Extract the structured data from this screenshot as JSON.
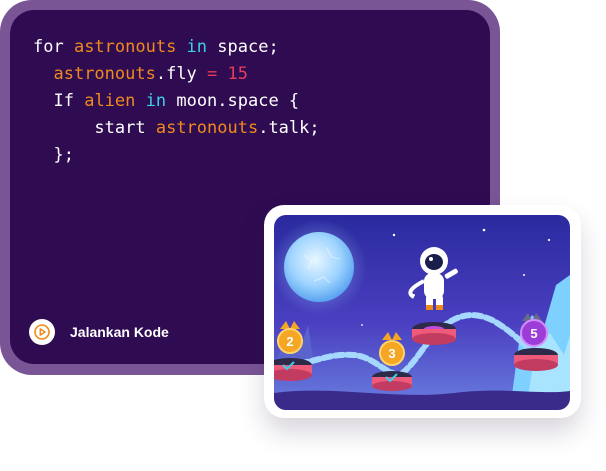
{
  "code": {
    "lines": [
      {
        "indent": "",
        "tokens": [
          {
            "text": "for ",
            "color": "#ffffff"
          },
          {
            "text": "astronouts",
            "color": "#f08a1c"
          },
          {
            "text": " in ",
            "color": "#3ad0e8"
          },
          {
            "text": "space;",
            "color": "#ffffff"
          }
        ]
      },
      {
        "indent": "  ",
        "tokens": [
          {
            "text": "astronouts",
            "color": "#f08a1c"
          },
          {
            "text": ".fly ",
            "color": "#ffffff"
          },
          {
            "text": "=",
            "color": "#e83a5a"
          },
          {
            "text": " 15",
            "color": "#e83a5a"
          }
        ]
      },
      {
        "indent": "  ",
        "tokens": [
          {
            "text": "If ",
            "color": "#ffffff"
          },
          {
            "text": "alien",
            "color": "#f08a1c"
          },
          {
            "text": " in ",
            "color": "#3ad0e8"
          },
          {
            "text": "moon.space {",
            "color": "#ffffff"
          }
        ]
      },
      {
        "indent": "      ",
        "tokens": [
          {
            "text": "start ",
            "color": "#ffffff"
          },
          {
            "text": "astronouts",
            "color": "#f08a1c"
          },
          {
            "text": ".talk;",
            "color": "#ffffff"
          }
        ]
      },
      {
        "indent": "  ",
        "tokens": [
          {
            "text": "};",
            "color": "#ffffff"
          }
        ]
      }
    ]
  },
  "run_button": {
    "label": "Jalankan Kode",
    "icon": "play-icon",
    "accent": "#f08a1c"
  },
  "game": {
    "levels": [
      {
        "number": "2",
        "color": "#f5a623"
      },
      {
        "number": "3",
        "color": "#f5a623"
      },
      {
        "number": "5",
        "color": "#9b3dd6"
      }
    ]
  }
}
